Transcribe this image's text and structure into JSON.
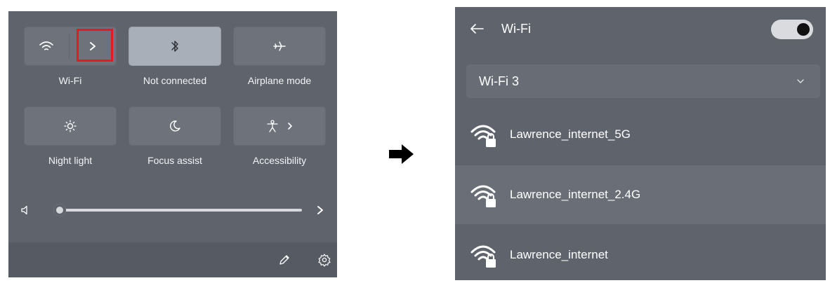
{
  "quick_settings": {
    "tiles": [
      {
        "label": "Wi-Fi",
        "icon": "wifi-icon",
        "state": "off"
      },
      {
        "label": "Not connected",
        "icon": "bluetooth-icon",
        "state": "on"
      },
      {
        "label": "Airplane mode",
        "icon": "airplane-icon",
        "state": "off"
      },
      {
        "label": "Night light",
        "icon": "brightness-icon",
        "state": "off"
      },
      {
        "label": "Focus assist",
        "icon": "moon-icon",
        "state": "off"
      },
      {
        "label": "Accessibility",
        "icon": "accessibility-icon",
        "state": "off"
      }
    ],
    "volume_level": 0.0,
    "footer_icons": [
      "edit-icon",
      "settings-icon"
    ]
  },
  "wifi_panel": {
    "title": "Wi-Fi",
    "toggle_on": true,
    "adapter_selected": "Wi-Fi 3",
    "networks": [
      {
        "name": "Lawrence_internet_5G",
        "secured": true,
        "selected": false
      },
      {
        "name": "Lawrence_internet_2.4G",
        "secured": true,
        "selected": true
      },
      {
        "name": "Lawrence_internet",
        "secured": true,
        "selected": false
      }
    ]
  },
  "colors": {
    "panel_bg": "#5f636c",
    "tile_bg": "#6e727b",
    "tile_active_bg": "#a9afb8",
    "highlight_box": "#e01b24",
    "selected_row_bg": "#6a6e77"
  }
}
